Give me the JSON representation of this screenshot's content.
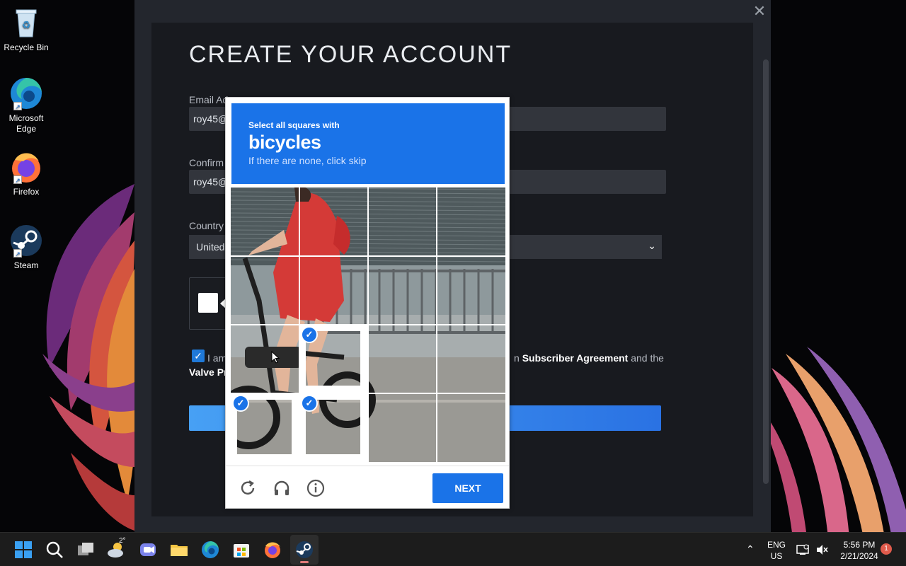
{
  "desktop": {
    "icons": [
      {
        "label": "Recycle Bin"
      },
      {
        "label": "Microsoft Edge"
      },
      {
        "label": "Firefox"
      },
      {
        "label": "Steam"
      }
    ]
  },
  "steam": {
    "title": "CREATE YOUR ACCOUNT",
    "email_label": "Email Ad",
    "email_value": "roy45@",
    "confirm_label": "Confirm",
    "confirm_value": "roy45@",
    "country_label": "Country",
    "country_value": "United",
    "agree_prefix": "I am",
    "agree_link1": "Subscriber Agreement",
    "agree_suffix": "and the",
    "agree_line2": "Valve Pr",
    "agree_prefix_char": "n",
    "close_glyph": "✕"
  },
  "captcha": {
    "instruction_small": "Select all squares with",
    "target": "bicycles",
    "hint": "If there are none, click skip",
    "next_label": "NEXT",
    "selected_tiles": [
      9,
      12,
      13
    ]
  },
  "taskbar": {
    "weather_temp": "2°",
    "lang_line1": "ENG",
    "lang_line2": "US",
    "time": "5:56 PM",
    "date": "2/21/2024",
    "notification_count": "1"
  },
  "colors": {
    "captcha_blue": "#1a73e8",
    "steam_bg": "#23262d",
    "steam_button": "#2a72e3"
  }
}
